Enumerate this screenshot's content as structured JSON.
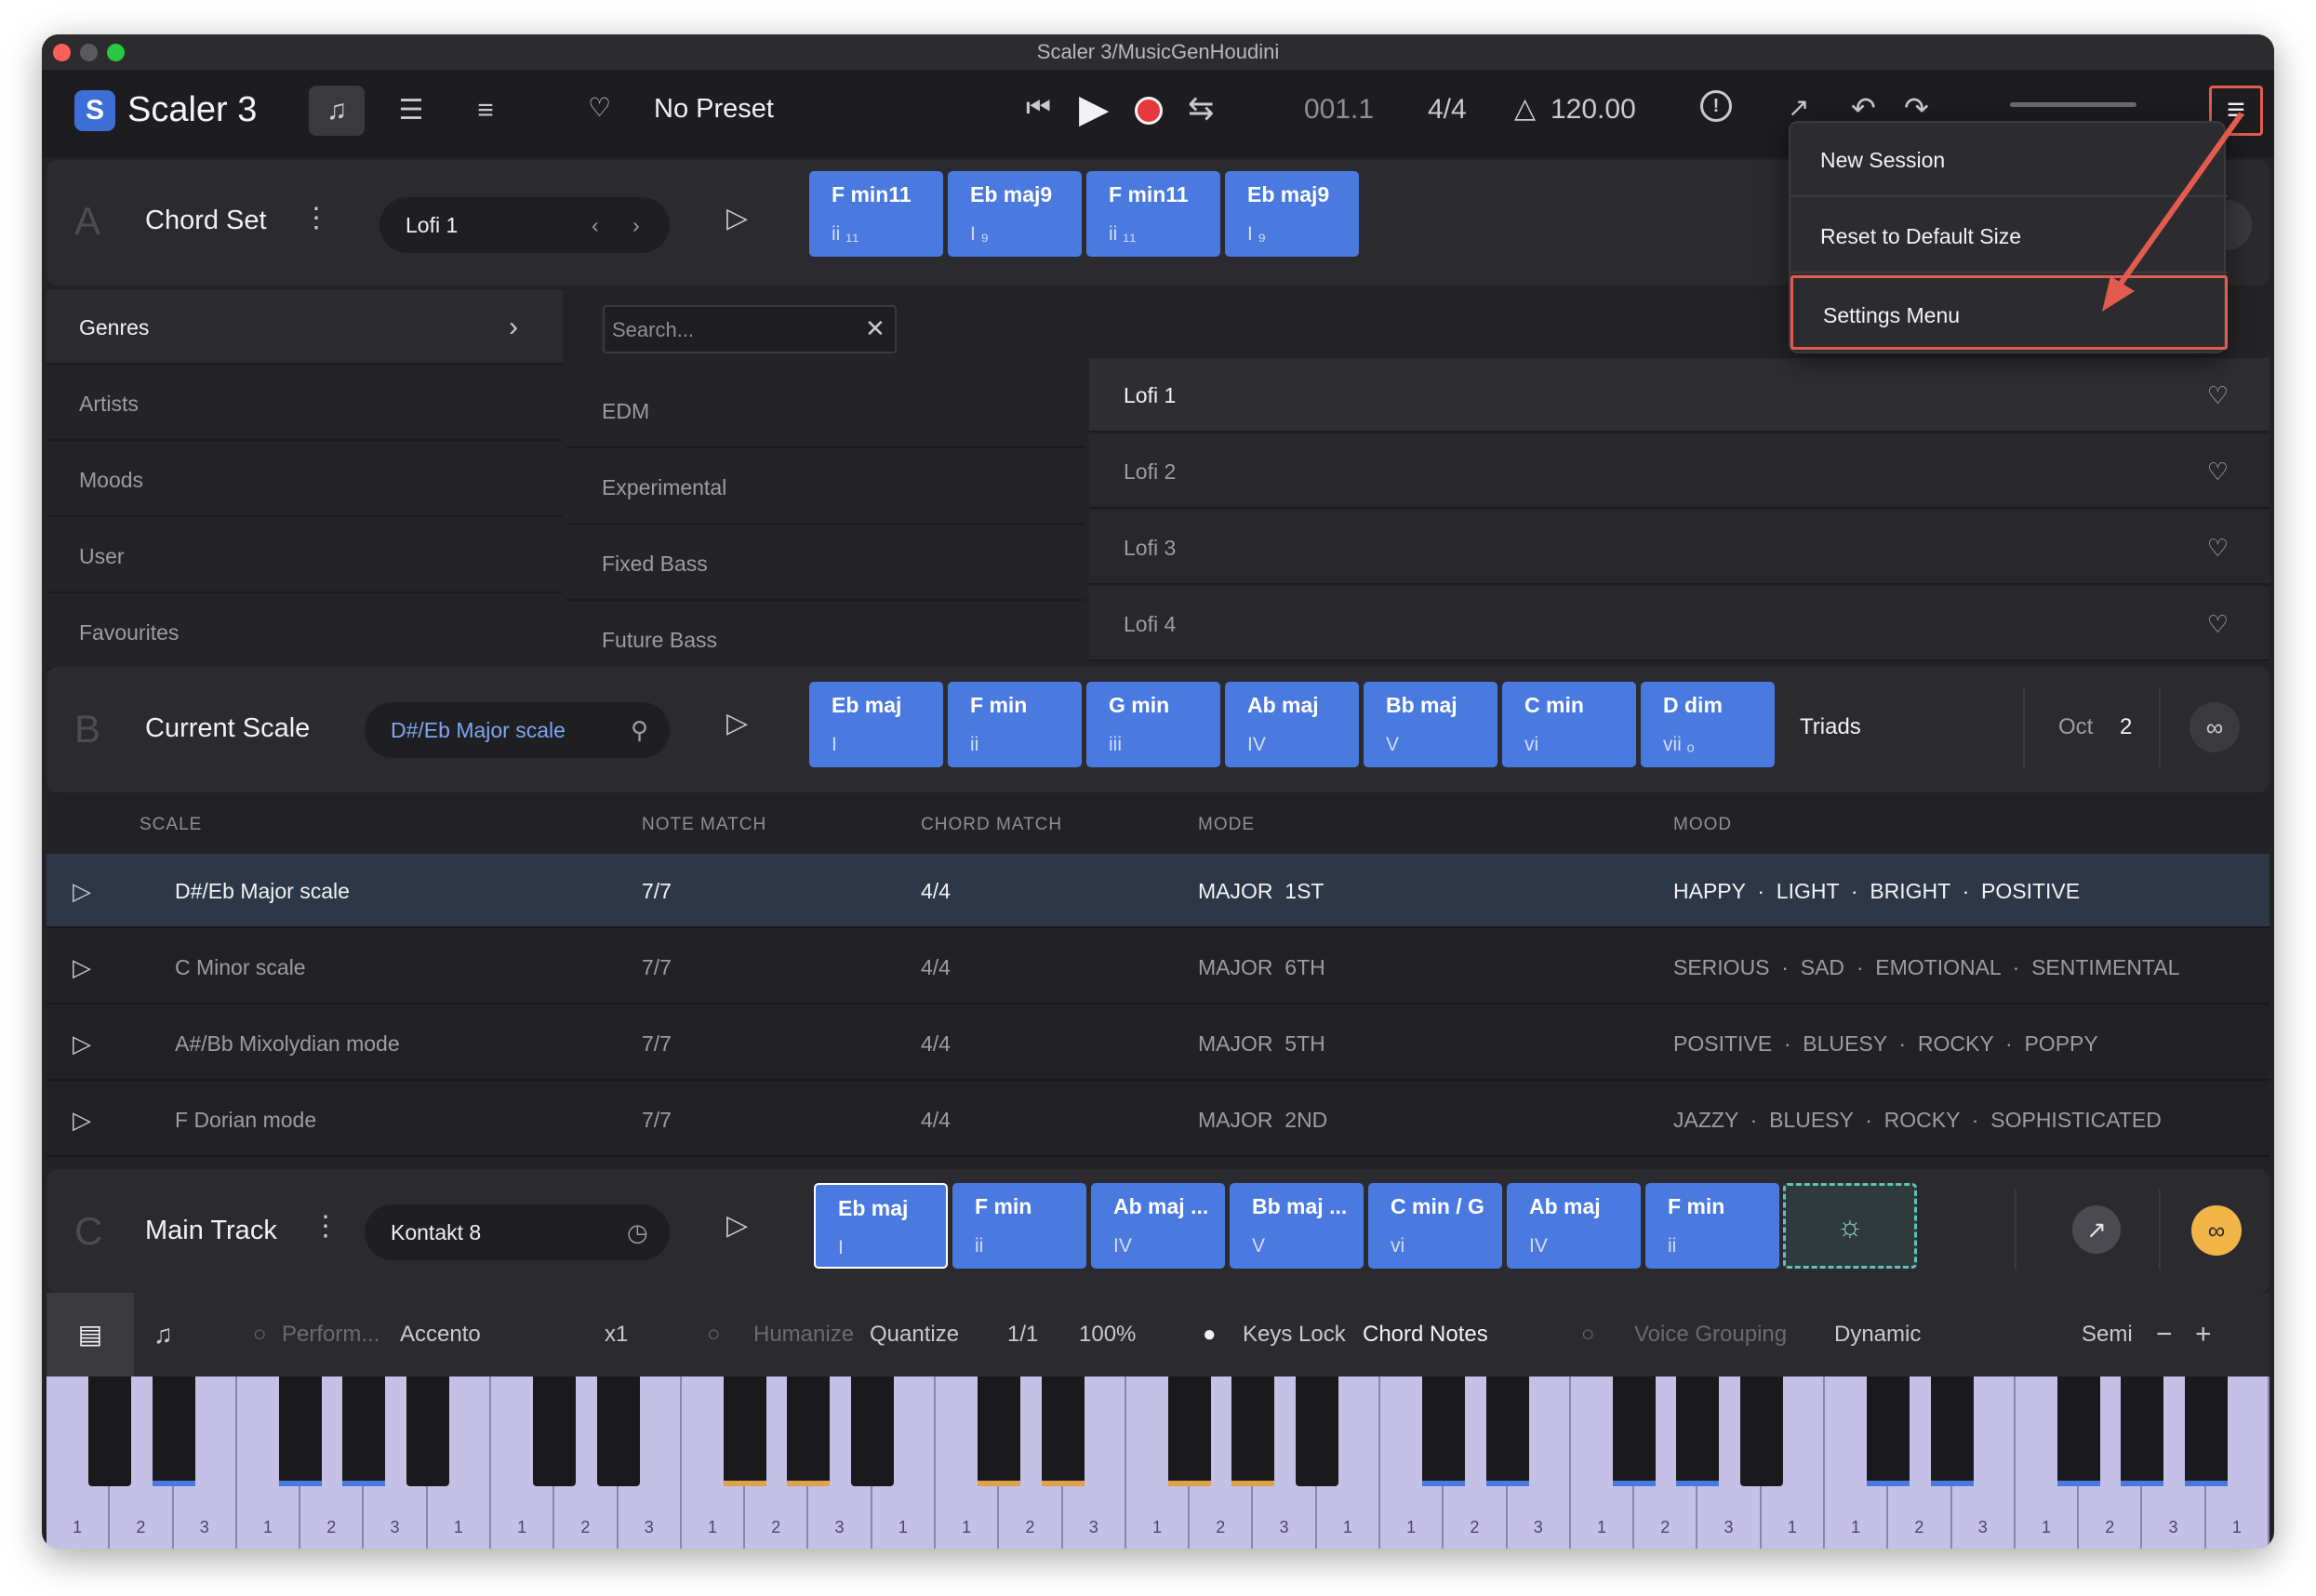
{
  "window": {
    "title": "Scaler 3/MusicGenHoudini"
  },
  "toolbar": {
    "app_name": "Scaler 3",
    "logo_letter": "S",
    "preset": "No Preset",
    "position": "001.1",
    "time_signature": "4/4",
    "tempo": "120.00"
  },
  "menu": {
    "items": [
      "New Session",
      "Reset to Default Size",
      "Settings Menu"
    ],
    "highlighted": "Settings Menu"
  },
  "section_a": {
    "letter": "A",
    "title": "Chord Set",
    "preset": "Lofi 1",
    "chords": [
      {
        "name": "F min11",
        "roman": "ii ₁₁"
      },
      {
        "name": "Eb maj9",
        "roman": "I ₉"
      },
      {
        "name": "F min11",
        "roman": "ii ₁₁"
      },
      {
        "name": "Eb maj9",
        "roman": "I ₉"
      }
    ]
  },
  "browser": {
    "categories": [
      "Genres",
      "Artists",
      "Moods",
      "User",
      "Favourites"
    ],
    "search_placeholder": "Search...",
    "genres": [
      "EDM",
      "Experimental",
      "Fixed Bass",
      "Future Bass"
    ],
    "sets": [
      "Lofi 1",
      "Lofi 2",
      "Lofi 3",
      "Lofi 4"
    ]
  },
  "section_b": {
    "letter": "B",
    "title": "Current Scale",
    "scale": "D#/Eb Major scale",
    "chords": [
      {
        "name": "Eb maj",
        "roman": "I"
      },
      {
        "name": "F min",
        "roman": "ii"
      },
      {
        "name": "G min",
        "roman": "iii"
      },
      {
        "name": "Ab maj",
        "roman": "IV"
      },
      {
        "name": "Bb maj",
        "roman": "V"
      },
      {
        "name": "C min",
        "roman": "vi"
      },
      {
        "name": "D dim",
        "roman": "vii ₒ"
      }
    ],
    "voicing": "Triads",
    "oct_label": "Oct",
    "oct_value": "2"
  },
  "scale_table": {
    "headers": [
      "SCALE",
      "NOTE MATCH",
      "CHORD MATCH",
      "MODE",
      "MOOD"
    ],
    "rows": [
      {
        "scale": "D#/Eb Major scale",
        "note": "7/7",
        "chord": "4/4",
        "mode": "MAJOR  1ST",
        "mood": "HAPPY  ·  LIGHT  ·  BRIGHT  ·  POSITIVE"
      },
      {
        "scale": "C Minor scale",
        "note": "7/7",
        "chord": "4/4",
        "mode": "MAJOR  6TH",
        "mood": "SERIOUS  ·  SAD  ·  EMOTIONAL  ·  SENTIMENTAL"
      },
      {
        "scale": "A#/Bb Mixolydian mode",
        "note": "7/7",
        "chord": "4/4",
        "mode": "MAJOR  5TH",
        "mood": "POSITIVE  ·  BLUESY  ·  ROCKY  ·  POPPY"
      },
      {
        "scale": "F Dorian mode",
        "note": "7/7",
        "chord": "4/4",
        "mode": "MAJOR  2ND",
        "mood": "JAZZY  ·  BLUESY  ·  ROCKY  ·  SOPHISTICATED"
      }
    ]
  },
  "section_c": {
    "letter": "C",
    "title": "Main Track",
    "instrument": "Kontakt 8",
    "chords": [
      {
        "name": "Eb maj",
        "roman": "I"
      },
      {
        "name": "F min",
        "roman": "ii"
      },
      {
        "name": "Ab maj ...",
        "roman": "IV"
      },
      {
        "name": "Bb maj ...",
        "roman": "V"
      },
      {
        "name": "C min / G",
        "roman": "vi"
      },
      {
        "name": "Ab maj",
        "roman": "IV"
      },
      {
        "name": "F min",
        "roman": "ii"
      }
    ]
  },
  "controls": {
    "perform": "Perform...",
    "accento": "Accento",
    "multiplier": "x1",
    "humanize": "Humanize",
    "quantize": "Quantize",
    "quantize_value": "1/1",
    "percent": "100%",
    "keys_lock": "Keys Lock",
    "chord_notes": "Chord Notes",
    "voice_grouping": "Voice Grouping",
    "dynamic": "Dynamic",
    "semi": "Semi"
  },
  "keyboard": {
    "labels": [
      "1",
      "2",
      "3",
      "1",
      "2",
      "3",
      "1",
      "1",
      "2",
      "3",
      "1",
      "2",
      "3",
      "1",
      "1",
      "2",
      "3",
      "1",
      "2",
      "3",
      "1",
      "1",
      "2",
      "3",
      "1",
      "2",
      "3",
      "1",
      "1",
      "2",
      "3",
      "1",
      "2",
      "3",
      "1"
    ]
  },
  "colors": {
    "accent": "#4a7ae0",
    "highlight_box": "#e35b4f",
    "orange_key": "#e0a24a",
    "blue_key": "#4a7ae0",
    "link_active": "#f0b546"
  }
}
